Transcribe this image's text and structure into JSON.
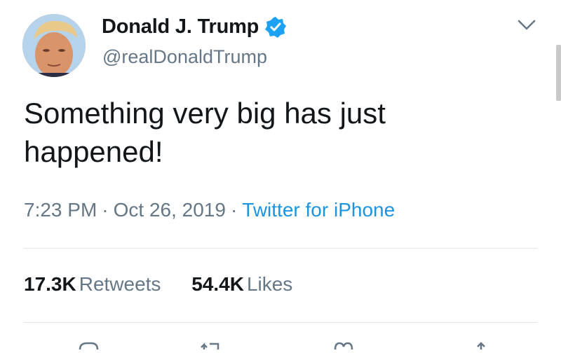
{
  "tweet": {
    "display_name": "Donald J. Trump",
    "handle": "@realDonaldTrump",
    "text": "Something very big has just happened!",
    "time": "7:23 PM",
    "date": "Oct 26, 2019",
    "source": "Twitter for iPhone",
    "separator": "·"
  },
  "stats": {
    "retweets_count": "17.3K",
    "retweets_label": "Retweets",
    "likes_count": "54.4K",
    "likes_label": "Likes"
  },
  "colors": {
    "accent": "#1b95e0",
    "verified": "#1da1f2",
    "secondary_text": "#657786",
    "divider": "#e1e8ed"
  },
  "icons": {
    "verified": "verified-badge-icon",
    "caret": "chevron-down-icon",
    "reply": "reply-icon",
    "retweet": "retweet-icon",
    "like": "heart-icon",
    "share": "share-icon"
  }
}
